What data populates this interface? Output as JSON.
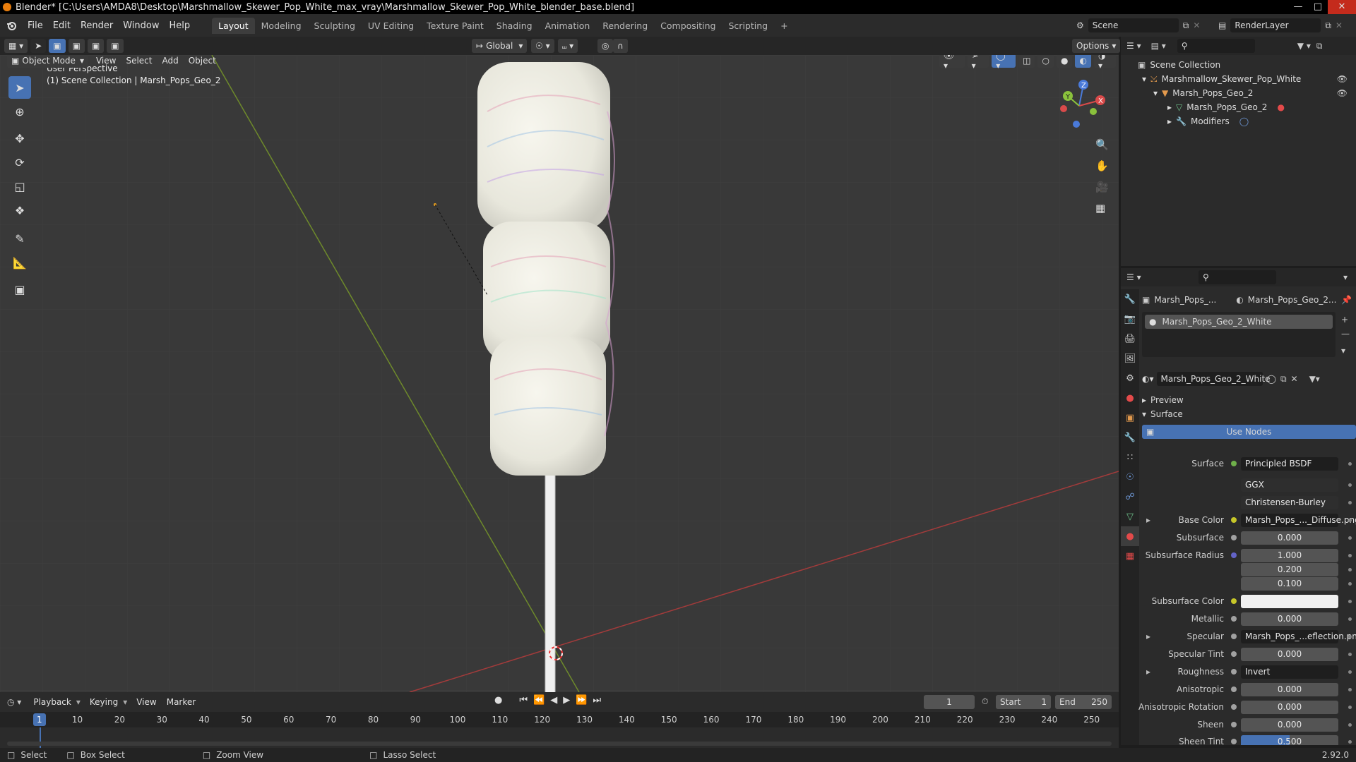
{
  "window": {
    "title": "Blender* [C:\\Users\\AMDA8\\Desktop\\Marshmallow_Skewer_Pop_White_max_vray\\Marshmallow_Skewer_Pop_White_blender_base.blend]"
  },
  "menu": [
    "File",
    "Edit",
    "Render",
    "Window",
    "Help"
  ],
  "workspaces": [
    "Layout",
    "Modeling",
    "Sculpting",
    "UV Editing",
    "Texture Paint",
    "Shading",
    "Animation",
    "Rendering",
    "Compositing",
    "Scripting"
  ],
  "scene": {
    "name": "Scene",
    "render_layer": "RenderLayer"
  },
  "viewport_header": {
    "mode": "Object Mode",
    "menus": [
      "View",
      "Select",
      "Add",
      "Object"
    ],
    "transform_orientation": "Global",
    "options": "Options"
  },
  "viewport": {
    "overlay_line1": "User Perspective",
    "overlay_line2": "(1) Scene Collection | Marsh_Pops_Geo_2",
    "axis_x": "X",
    "axis_y": "Y",
    "axis_z": "Z"
  },
  "outliner": {
    "root": "Scene Collection",
    "items": [
      {
        "label": "Marshmallow_Skewer_Pop_White"
      },
      {
        "label": "Marsh_Pops_Geo_2"
      },
      {
        "label": "Marsh_Pops_Geo_2"
      },
      {
        "label": "Modifiers"
      }
    ]
  },
  "properties": {
    "breadcrumb_object": "Marsh_Pops_...",
    "breadcrumb_material": "Marsh_Pops_Geo_2...",
    "material_slot": "Marsh_Pops_Geo_2_White",
    "material_name": "Marsh_Pops_Geo_2_White",
    "preview_label": "Preview",
    "surface_label": "Surface",
    "use_nodes": "Use Nodes",
    "rows": [
      {
        "label": "Surface",
        "value": "Principled BSDF",
        "dot": "#6fb04a",
        "style": "dark"
      },
      {
        "label": "",
        "value": "GGX",
        "dot": "",
        "style": "dark"
      },
      {
        "label": "",
        "value": "Christensen-Burley",
        "dot": "",
        "style": "dark"
      },
      {
        "label": "Base Color",
        "value": "Marsh_Pops_..._Diffuse.png",
        "dot": "#c7c729",
        "style": "dark"
      },
      {
        "label": "Subsurface",
        "value": "0.000",
        "dot": "#a1a1a1",
        "style": "num"
      },
      {
        "label": "Subsurface Radius",
        "value": "1.000",
        "dot": "#6363c7",
        "style": "num"
      },
      {
        "label": "",
        "value": "0.200",
        "dot": "",
        "style": "num"
      },
      {
        "label": "",
        "value": "0.100",
        "dot": "",
        "style": "num"
      },
      {
        "label": "Subsurface Color",
        "value": "",
        "dot": "#c7c729",
        "style": "white"
      },
      {
        "label": "Metallic",
        "value": "0.000",
        "dot": "#a1a1a1",
        "style": "num"
      },
      {
        "label": "Specular",
        "value": "Marsh_Pops_...eflection.png",
        "dot": "#a1a1a1",
        "style": "dark"
      },
      {
        "label": "Specular Tint",
        "value": "0.000",
        "dot": "#a1a1a1",
        "style": "num"
      },
      {
        "label": "Roughness",
        "value": "Invert",
        "dot": "#a1a1a1",
        "style": "dark"
      },
      {
        "label": "Anisotropic",
        "value": "0.000",
        "dot": "#a1a1a1",
        "style": "num"
      },
      {
        "label": "Anisotropic Rotation",
        "value": "0.000",
        "dot": "#a1a1a1",
        "style": "num"
      },
      {
        "label": "Sheen",
        "value": "0.000",
        "dot": "#a1a1a1",
        "style": "num"
      },
      {
        "label": "Sheen Tint",
        "value": "0.500",
        "dot": "#a1a1a1",
        "style": "blue"
      }
    ]
  },
  "timeline": {
    "menus": [
      "Playback",
      "Keying",
      "View",
      "Marker"
    ],
    "current_frame": "1",
    "start_label": "Start",
    "start": "1",
    "end_label": "End",
    "end": "250",
    "ticks": [
      "1",
      "10",
      "20",
      "30",
      "40",
      "50",
      "60",
      "70",
      "80",
      "90",
      "100",
      "110",
      "120",
      "130",
      "140",
      "150",
      "160",
      "170",
      "180",
      "190",
      "200",
      "210",
      "220",
      "230",
      "240",
      "250"
    ]
  },
  "statusbar": {
    "select": "Select",
    "box_select": "Box Select",
    "zoom_view": "Zoom View",
    "lasso_select": "Lasso Select",
    "version": "2.92.0"
  },
  "colors": {
    "accent": "#4772b3",
    "viewport_bg": "#393939",
    "panel_bg": "#2b2b2b"
  }
}
